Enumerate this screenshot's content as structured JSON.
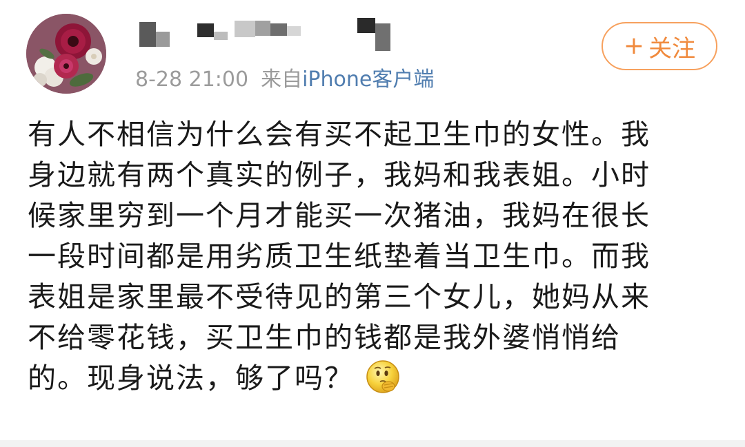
{
  "post": {
    "username": "",
    "timestamp": "8-28 21:00",
    "source_prefix": "来自",
    "source_client": "iPhone客户端",
    "follow_label": "关注",
    "follow_icon": "plus-icon",
    "avatar_icon": "flower-avatar",
    "content_lines": [
      "有人不相信为什么会有买不起卫生巾的女性。我",
      "身边就有两个真实的例子，我妈和我表姐。小时",
      "候家里穷到一个月才能买一次猪油，我妈在很长",
      "一段时间都是用劣质卫生纸垫着当卫生巾。而我",
      "表姐是家里最不受待见的第三个女儿，她妈从来",
      "不给零花钱，买卫生巾的钱都是我外婆悄悄给",
      "的。现身说法，够了吗？"
    ],
    "trailing_emoji": "thinking-face-emoji",
    "colors": {
      "accent_orange": "#f08a3d",
      "link_blue": "#507daf",
      "meta_gray": "#9b9b9b",
      "text_dark": "#1a1a1a"
    }
  }
}
